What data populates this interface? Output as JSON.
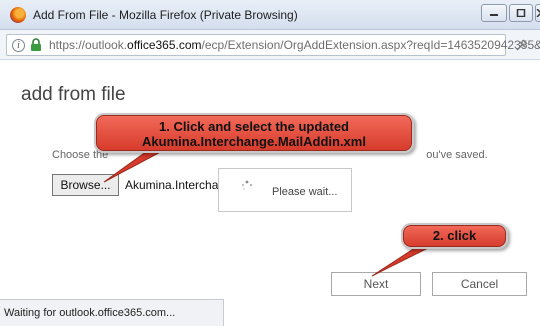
{
  "window": {
    "title": "Add From File - Mozilla Firefox (Private Browsing)"
  },
  "urlbar": {
    "url_prefix": "https://outlook.",
    "url_domain": "office365.com",
    "url_path": "/ecp/Extension/OrgAddExtension.aspx?reqId=1463520942355&pv"
  },
  "page": {
    "title": "add from file",
    "choose_prefix": "Choose the",
    "choose_suffix": "ou've saved."
  },
  "file_picker": {
    "browse_label": "Browse...",
    "file_name": "Akumina.Interchan"
  },
  "wait_dialog": {
    "text": "Please wait..."
  },
  "annotations": {
    "callout_1_line_1": "1. Click  and select the updated",
    "callout_1_line_2": "Akumina.Interchange.MailAddin.xml",
    "callout_2": "2. click",
    "color": "#e0473a"
  },
  "buttons": {
    "next": "Next",
    "cancel": "Cancel"
  },
  "statusbar": {
    "text": "Waiting for outlook.office365.com..."
  }
}
